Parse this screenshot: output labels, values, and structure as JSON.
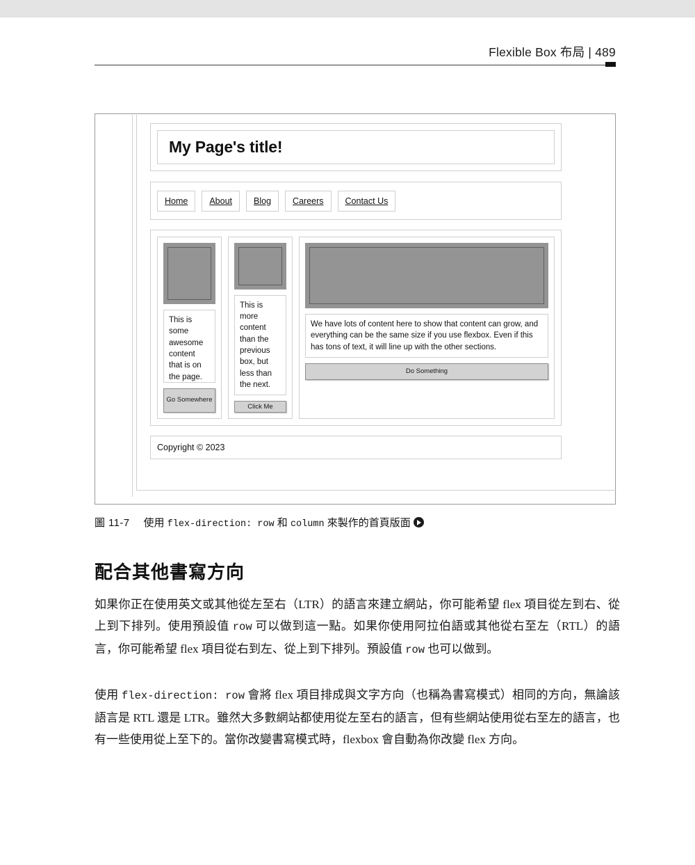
{
  "page": {
    "running_head": "Flexible Box 布局 | 489",
    "page_number": "489"
  },
  "figure": {
    "caption_number": "圖 11-7",
    "caption_text_1": "使用 ",
    "caption_code_1": "flex-direction: row",
    "caption_text_2": " 和 ",
    "caption_code_2": "column",
    "caption_text_3": " 來製作的首頁版面",
    "caption_badge_icon": "play-circle-icon",
    "mockup": {
      "title": "My Page's title!",
      "nav": [
        {
          "label": "Home"
        },
        {
          "label": "About"
        },
        {
          "label": "Blog"
        },
        {
          "label": "Careers"
        },
        {
          "label": "Contact Us"
        }
      ],
      "columns": [
        {
          "image_alt": "image-placeholder",
          "text": "This is some awesome content that is on the page.",
          "button": "Go Somewhere"
        },
        {
          "image_alt": "image-placeholder",
          "text": "This is more content than the previous box, but less than the next.",
          "button": "Click Me"
        },
        {
          "image_alt": "image-placeholder",
          "text": "We have lots of content here to show that content can grow, and everything can be the same size if you use flexbox. Even if this has tons of text, it will line up with the other sections.",
          "button": "Do Something"
        }
      ],
      "footer": "Copyright © 2023"
    }
  },
  "content": {
    "section_heading": "配合其他書寫方向",
    "paragraph_1": {
      "part_1": "如果你正在使用英文或其他從左至右（LTR）的語言來建立網站，你可能希望 flex 項目從左到右、從上到下排列。使用預設值 ",
      "code_1": "row",
      "part_2": " 可以做到這一點。如果你使用阿拉伯語或其他從右至左（RTL）的語言，你可能希望 flex 項目從右到左、從上到下排列。預設值 ",
      "code_2": "row",
      "part_3": " 也可以做到。"
    },
    "paragraph_2": {
      "part_1": "使用 ",
      "code_1": "flex-direction: row",
      "part_2": " 會將 flex 項目排成與文字方向（也稱為書寫模式）相同的方向，無論該語言是 RTL 還是 LTR。雖然大多數網站都使用從左至右的語言，但有些網站使用從右至左的語言，也有一些使用從上至下的。當你改變書寫模式時，flexbox 會自動為你改變 flex 方向。"
    }
  },
  "colors": {
    "image_placeholder": "#949494",
    "button_fill": "#d2d2d2",
    "border": "#cfcfcf",
    "chrome_strip": "#e4e4e4"
  }
}
